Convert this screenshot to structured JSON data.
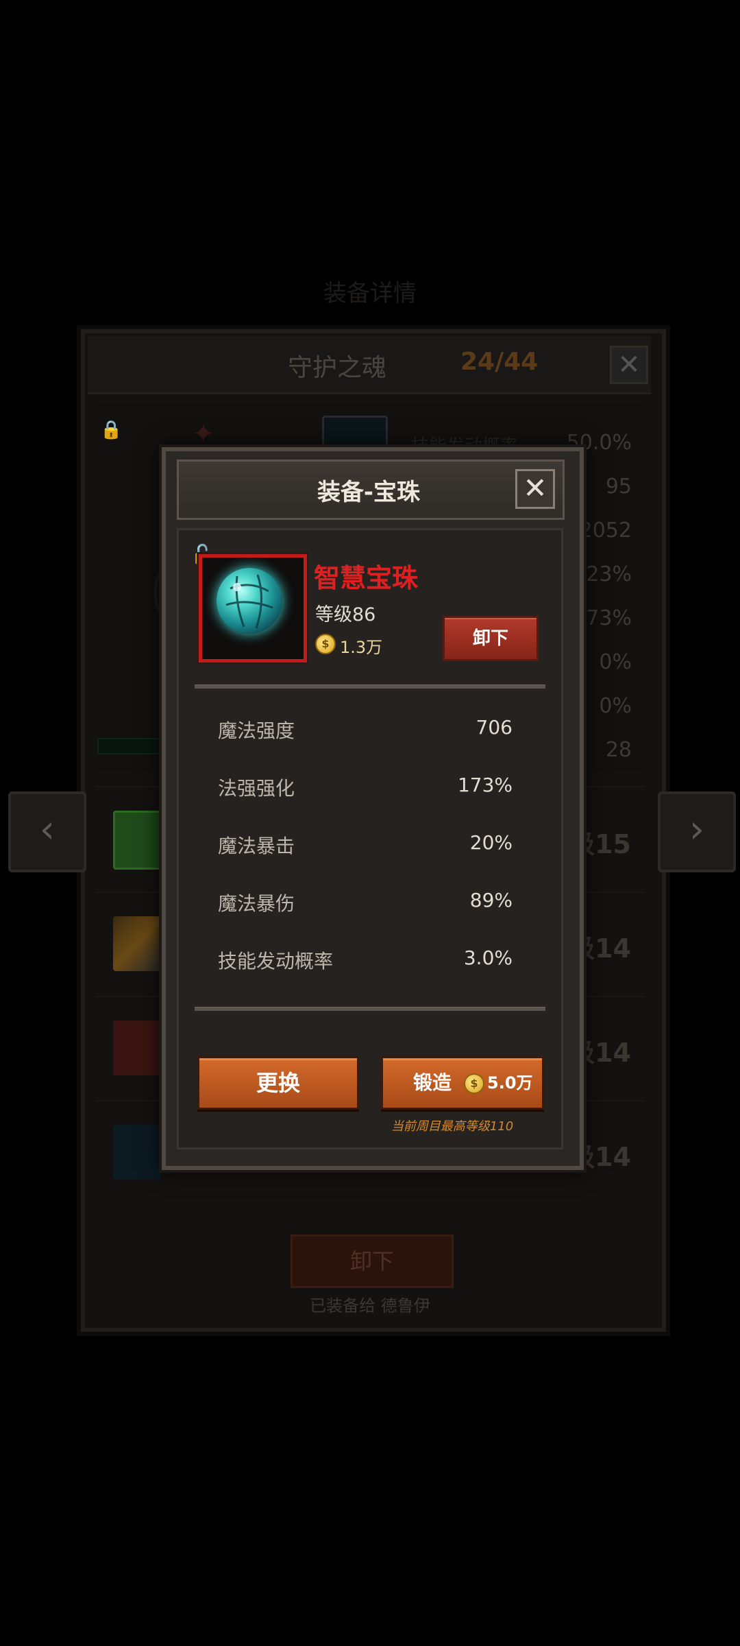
{
  "background": {
    "header_title": "装备详情",
    "panel_title": "守护之魂",
    "panel_count": "24/44",
    "stat_label_faint": "技能发动概率",
    "stat_values": [
      "50.0%",
      "95",
      "2052",
      "23%",
      "273%",
      "0%",
      "0%",
      "28"
    ],
    "item_levels": [
      "级15",
      "级14",
      "级14",
      "级14"
    ],
    "unequip_label": "卸下",
    "equipped_to": "已装备给 德鲁伊",
    "left_arrow": "‹",
    "right_arrow": "›"
  },
  "modal": {
    "title": "装备-宝珠",
    "close": "✕",
    "item": {
      "name": "智慧宝珠",
      "level": "等级86",
      "price": "1.3万",
      "unequip_label": "卸下"
    },
    "stats": [
      {
        "label": "魔法强度",
        "value": "706"
      },
      {
        "label": "法强强化",
        "value": "173%"
      },
      {
        "label": "魔法暴击",
        "value": "20%"
      },
      {
        "label": "魔法暴伤",
        "value": "89%"
      },
      {
        "label": "技能发动概率",
        "value": "3.0%"
      }
    ],
    "replace_label": "更换",
    "forge_label": "锻造",
    "forge_cost": "5.0万",
    "max_level_note": "当前周目最高等级110"
  },
  "colors": {
    "item_name": "#e02020",
    "accent_orange": "#c85e22",
    "max_level_note": "#d2892e"
  }
}
